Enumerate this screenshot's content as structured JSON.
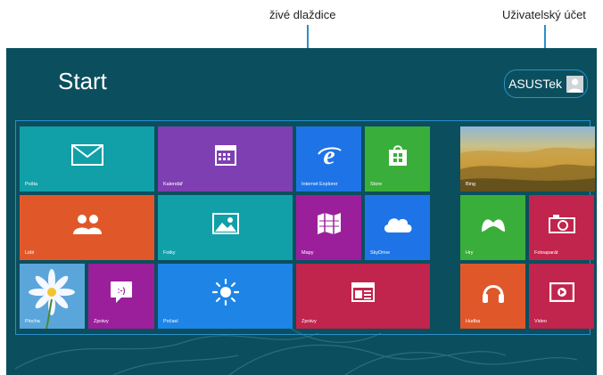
{
  "callouts": {
    "live_tiles": "živé dlaždice",
    "user_account": "Uživatelský účet"
  },
  "start": {
    "title": "Start",
    "user_name": "ASUSTek"
  },
  "tiles": {
    "posta": "Pošta",
    "kalendar": "Kalendář",
    "ie": "Internet Explorer",
    "store": "Store",
    "bing": "Bing",
    "lide": "Lidé",
    "fotky": "Fotky",
    "mapy": "Mapy",
    "skydrive": "SkyDrive",
    "hry": "Hry",
    "fotoaparat": "Fotoaparát",
    "plocha": "Plocha",
    "zpravy1": "Zprávy",
    "pocasi": "Počasí",
    "zpravy2": "Zprávy",
    "hudba": "Hudba",
    "video": "Video"
  },
  "colors": {
    "background": "#0b4f5e",
    "accent_outline": "#2a8fc8",
    "teal": "#11a0a8",
    "purple": "#7e3fb2",
    "blue": "#1e74e6",
    "green": "#3aae3a",
    "orange": "#e0582a",
    "magenta": "#9b1f9b",
    "crimson": "#c1244c"
  },
  "icons": {
    "posta": "mail-icon",
    "kalendar": "calendar-icon",
    "ie": "internet-explorer-icon",
    "store": "store-bag-icon",
    "lide": "people-icon",
    "fotky": "photo-icon",
    "mapy": "map-icon",
    "skydrive": "cloud-icon",
    "hry": "gamepad-icon",
    "fotoaparat": "camera-icon",
    "zpravy1": "chat-bubble-icon",
    "pocasi": "sun-icon",
    "zpravy2": "newspaper-icon",
    "hudba": "headphones-icon",
    "video": "video-play-icon",
    "user": "user-avatar-icon"
  }
}
